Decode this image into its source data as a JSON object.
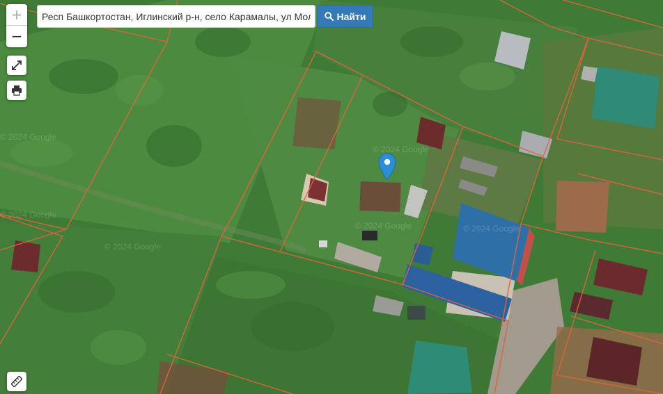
{
  "map": {
    "imagery_watermark": "© 2024 Google",
    "cadastral_line_color": "#e0643a",
    "marker_color": "#2a8fd8"
  },
  "controls": {
    "zoom_in_label": "+",
    "zoom_out_label": "−",
    "fullscreen_icon": "expand-icon",
    "print_icon": "print-icon",
    "measure_icon": "ruler-icon"
  },
  "search": {
    "value": "Респ Башкортостан, Иглинский р-н, село Карамалы, ул Молодежная",
    "button_label": "Найти",
    "button_icon": "search-icon"
  }
}
